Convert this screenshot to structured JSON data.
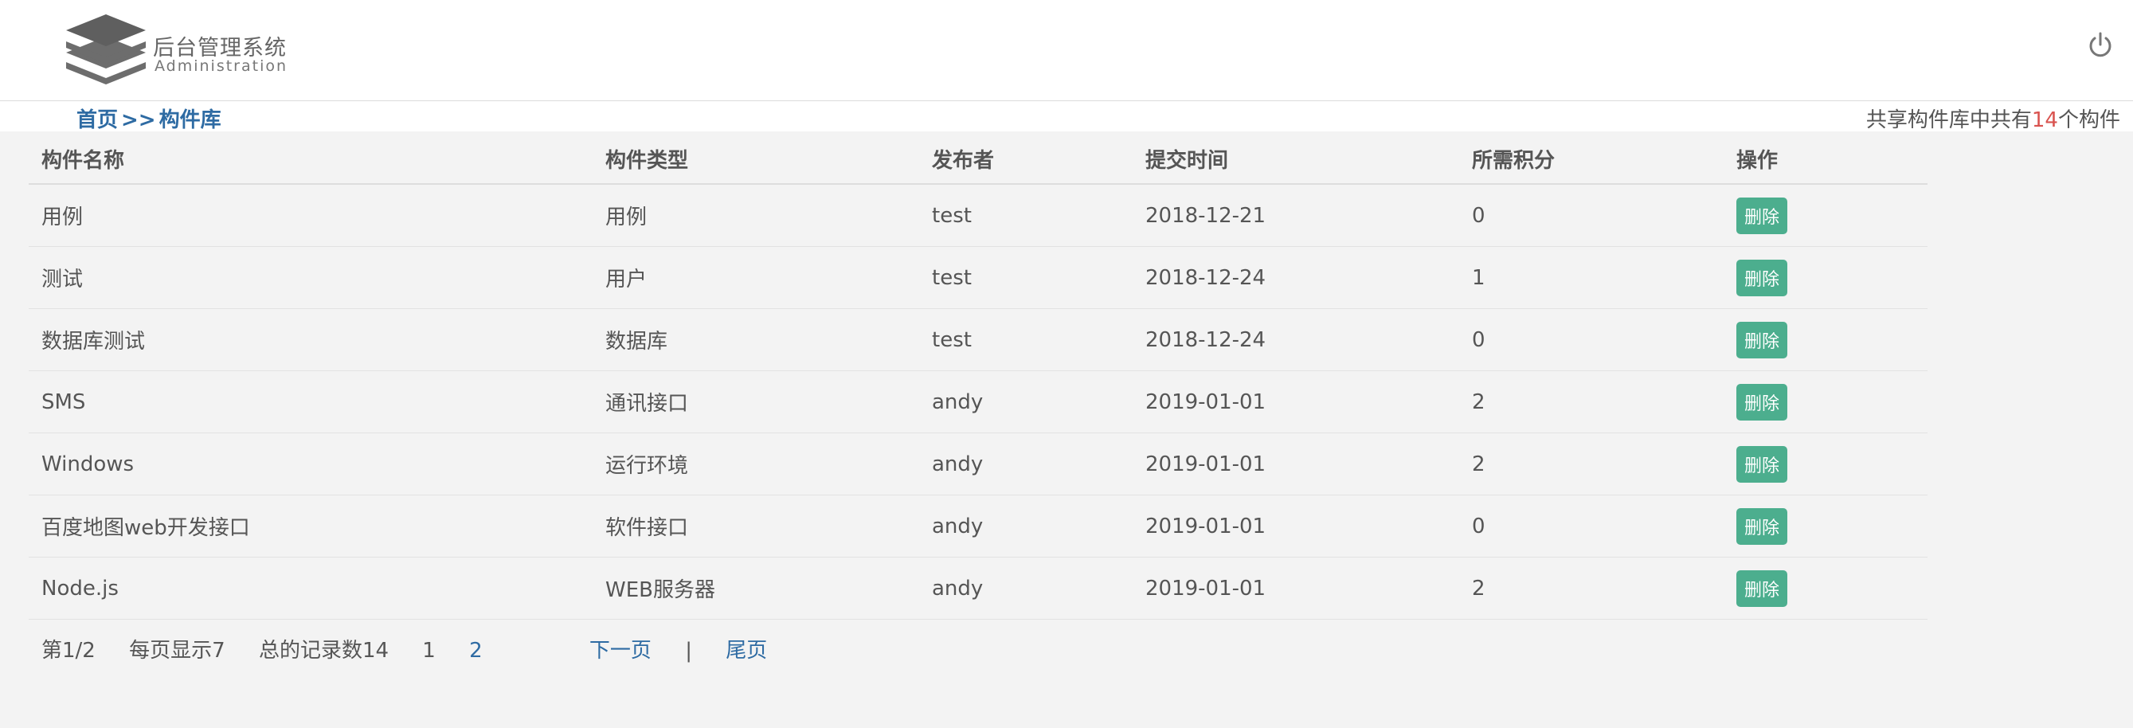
{
  "brand": {
    "title": "后台管理系统",
    "subtitle": "Administration"
  },
  "breadcrumb": {
    "home": "首页",
    "separator": ">>",
    "current": "构件库"
  },
  "summary": {
    "prefix": "共享构件库中共有",
    "count": "14",
    "suffix": "个构件"
  },
  "table": {
    "headers": [
      "构件名称",
      "构件类型",
      "发布者",
      "提交时间",
      "所需积分",
      "操作"
    ],
    "rows": [
      {
        "name": "用例",
        "type": "用例",
        "publisher": "test",
        "date": "2018-12-21",
        "points": "0",
        "action": "删除"
      },
      {
        "name": "测试",
        "type": "用户",
        "publisher": "test",
        "date": "2018-12-24",
        "points": "1",
        "action": "删除"
      },
      {
        "name": "数据库测试",
        "type": "数据库",
        "publisher": "test",
        "date": "2018-12-24",
        "points": "0",
        "action": "删除"
      },
      {
        "name": "SMS",
        "type": "通讯接口",
        "publisher": "andy",
        "date": "2019-01-01",
        "points": "2",
        "action": "删除"
      },
      {
        "name": "Windows",
        "type": "运行环境",
        "publisher": "andy",
        "date": "2019-01-01",
        "points": "2",
        "action": "删除"
      },
      {
        "name": "百度地图web开发接口",
        "type": "软件接口",
        "publisher": "andy",
        "date": "2019-01-01",
        "points": "0",
        "action": "删除"
      },
      {
        "name": "Node.js",
        "type": "WEB服务器",
        "publisher": "andy",
        "date": "2019-01-01",
        "points": "2",
        "action": "删除"
      }
    ]
  },
  "pager": {
    "page_info": "第1/2",
    "per_page": "每页显示7",
    "total": "总的记录数14",
    "pages": [
      "1",
      "2"
    ],
    "next": "下一页",
    "divider": "|",
    "last": "尾页"
  },
  "icons": {
    "logo": "stacked-layers-logo",
    "power": "power-icon"
  },
  "colors": {
    "link": "#2e6ba3",
    "delete_button": "#4cae8e",
    "highlight_count": "#d9534f",
    "background": "#f3f3f3"
  }
}
